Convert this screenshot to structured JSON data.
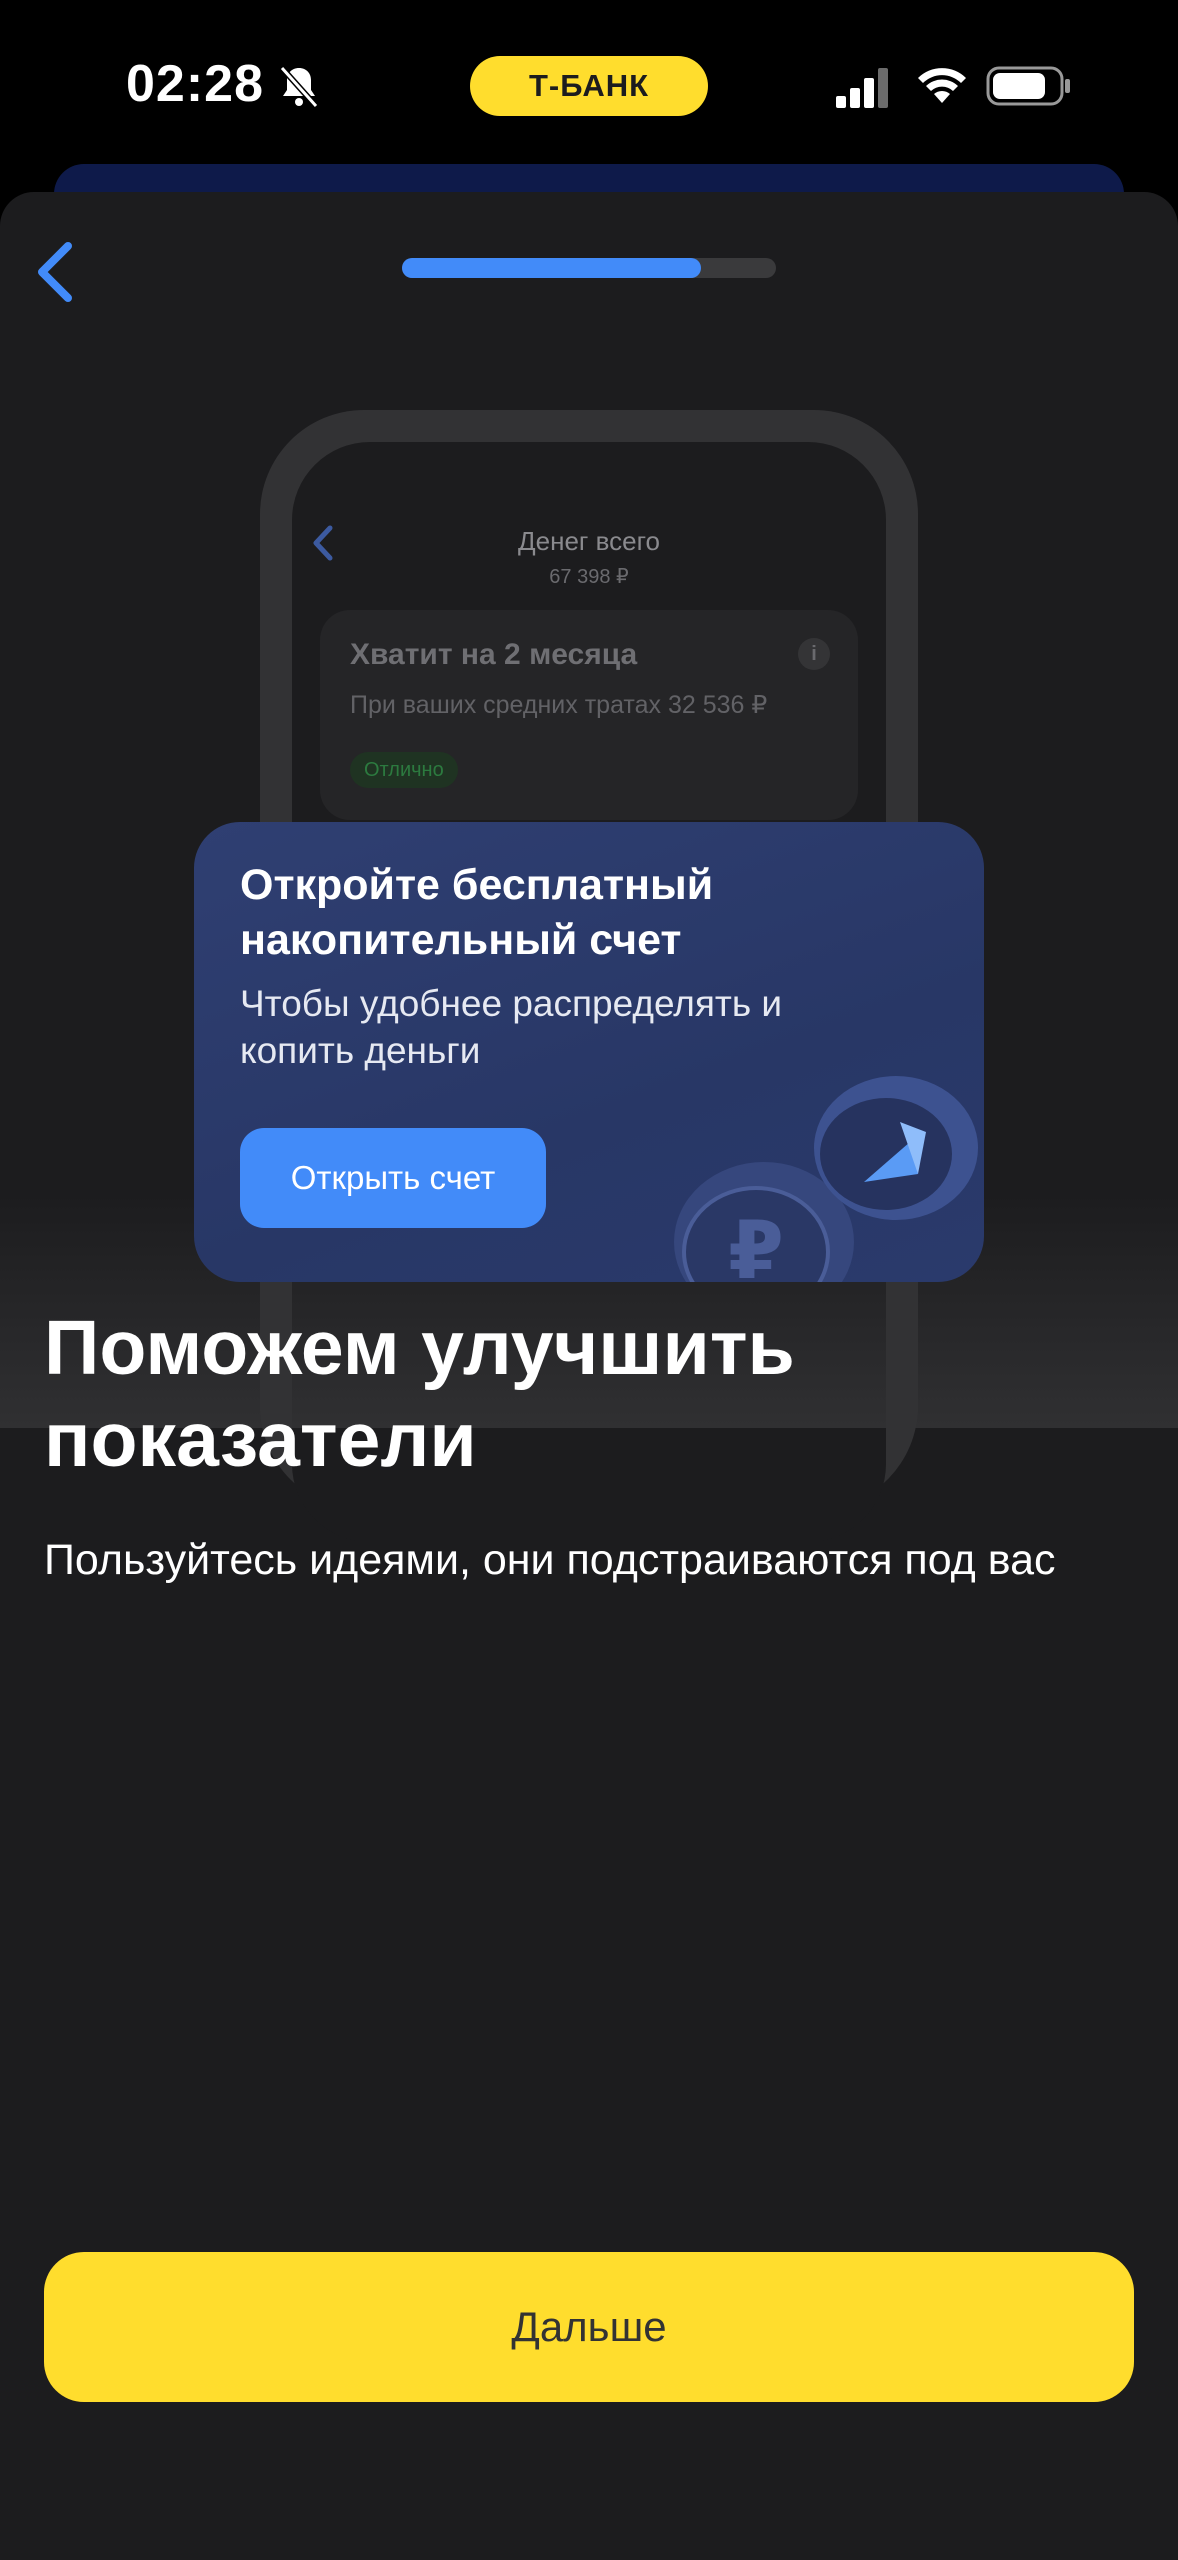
{
  "status_bar": {
    "time": "02:28",
    "bank_pill": "Т-БАНК",
    "icons": [
      "bell-slash-icon",
      "signal-icon",
      "wifi-icon",
      "battery-icon"
    ]
  },
  "nav": {
    "back_icon": "chevron-left-icon",
    "progress": 0.8
  },
  "illustration": {
    "phone_title": "Денег всего",
    "phone_subtitle": "67 398 ₽",
    "card_title": "Хватит на 2 месяца",
    "card_text": "При ваших средних тратах 32 536 ₽",
    "card_badge": "Отлично",
    "card_info": "i"
  },
  "promo": {
    "title": "Откройте бесплатный накопительный счет",
    "text": "Чтобы удобнее распределять и копить деньги",
    "button_label": "Открыть счет"
  },
  "headline": "Поможем улучшить показатели",
  "subtext": "Пользуйтесь идеями, они подстраиваются под вас",
  "next_button": "Дальше",
  "colors": {
    "background": "#1c1c1e",
    "accent_yellow": "#ffdd2d",
    "accent_blue": "#428bf9",
    "promo_card": "#2f3f72"
  }
}
